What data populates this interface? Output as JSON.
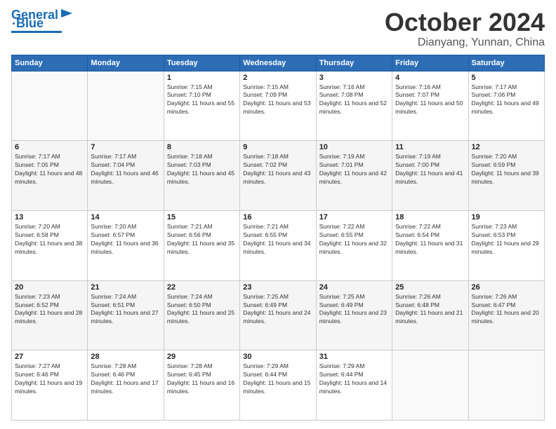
{
  "header": {
    "logo_line1": "General",
    "logo_line2": "Blue",
    "title": "October 2024",
    "location": "Dianyang, Yunnan, China"
  },
  "columns": [
    "Sunday",
    "Monday",
    "Tuesday",
    "Wednesday",
    "Thursday",
    "Friday",
    "Saturday"
  ],
  "weeks": [
    [
      {
        "day": "",
        "sunrise": "",
        "sunset": "",
        "daylight": ""
      },
      {
        "day": "",
        "sunrise": "",
        "sunset": "",
        "daylight": ""
      },
      {
        "day": "1",
        "sunrise": "Sunrise: 7:15 AM",
        "sunset": "Sunset: 7:10 PM",
        "daylight": "Daylight: 11 hours and 55 minutes."
      },
      {
        "day": "2",
        "sunrise": "Sunrise: 7:15 AM",
        "sunset": "Sunset: 7:09 PM",
        "daylight": "Daylight: 11 hours and 53 minutes."
      },
      {
        "day": "3",
        "sunrise": "Sunrise: 7:16 AM",
        "sunset": "Sunset: 7:08 PM",
        "daylight": "Daylight: 11 hours and 52 minutes."
      },
      {
        "day": "4",
        "sunrise": "Sunrise: 7:16 AM",
        "sunset": "Sunset: 7:07 PM",
        "daylight": "Daylight: 11 hours and 50 minutes."
      },
      {
        "day": "5",
        "sunrise": "Sunrise: 7:17 AM",
        "sunset": "Sunset: 7:06 PM",
        "daylight": "Daylight: 11 hours and 49 minutes."
      }
    ],
    [
      {
        "day": "6",
        "sunrise": "Sunrise: 7:17 AM",
        "sunset": "Sunset: 7:05 PM",
        "daylight": "Daylight: 11 hours and 48 minutes."
      },
      {
        "day": "7",
        "sunrise": "Sunrise: 7:17 AM",
        "sunset": "Sunset: 7:04 PM",
        "daylight": "Daylight: 11 hours and 46 minutes."
      },
      {
        "day": "8",
        "sunrise": "Sunrise: 7:18 AM",
        "sunset": "Sunset: 7:03 PM",
        "daylight": "Daylight: 11 hours and 45 minutes."
      },
      {
        "day": "9",
        "sunrise": "Sunrise: 7:18 AM",
        "sunset": "Sunset: 7:02 PM",
        "daylight": "Daylight: 11 hours and 43 minutes."
      },
      {
        "day": "10",
        "sunrise": "Sunrise: 7:19 AM",
        "sunset": "Sunset: 7:01 PM",
        "daylight": "Daylight: 11 hours and 42 minutes."
      },
      {
        "day": "11",
        "sunrise": "Sunrise: 7:19 AM",
        "sunset": "Sunset: 7:00 PM",
        "daylight": "Daylight: 11 hours and 41 minutes."
      },
      {
        "day": "12",
        "sunrise": "Sunrise: 7:20 AM",
        "sunset": "Sunset: 6:59 PM",
        "daylight": "Daylight: 11 hours and 39 minutes."
      }
    ],
    [
      {
        "day": "13",
        "sunrise": "Sunrise: 7:20 AM",
        "sunset": "Sunset: 6:58 PM",
        "daylight": "Daylight: 11 hours and 38 minutes."
      },
      {
        "day": "14",
        "sunrise": "Sunrise: 7:20 AM",
        "sunset": "Sunset: 6:57 PM",
        "daylight": "Daylight: 11 hours and 36 minutes."
      },
      {
        "day": "15",
        "sunrise": "Sunrise: 7:21 AM",
        "sunset": "Sunset: 6:56 PM",
        "daylight": "Daylight: 11 hours and 35 minutes."
      },
      {
        "day": "16",
        "sunrise": "Sunrise: 7:21 AM",
        "sunset": "Sunset: 6:55 PM",
        "daylight": "Daylight: 11 hours and 34 minutes."
      },
      {
        "day": "17",
        "sunrise": "Sunrise: 7:22 AM",
        "sunset": "Sunset: 6:55 PM",
        "daylight": "Daylight: 11 hours and 32 minutes."
      },
      {
        "day": "18",
        "sunrise": "Sunrise: 7:22 AM",
        "sunset": "Sunset: 6:54 PM",
        "daylight": "Daylight: 11 hours and 31 minutes."
      },
      {
        "day": "19",
        "sunrise": "Sunrise: 7:23 AM",
        "sunset": "Sunset: 6:53 PM",
        "daylight": "Daylight: 11 hours and 29 minutes."
      }
    ],
    [
      {
        "day": "20",
        "sunrise": "Sunrise: 7:23 AM",
        "sunset": "Sunset: 6:52 PM",
        "daylight": "Daylight: 11 hours and 28 minutes."
      },
      {
        "day": "21",
        "sunrise": "Sunrise: 7:24 AM",
        "sunset": "Sunset: 6:51 PM",
        "daylight": "Daylight: 11 hours and 27 minutes."
      },
      {
        "day": "22",
        "sunrise": "Sunrise: 7:24 AM",
        "sunset": "Sunset: 6:50 PM",
        "daylight": "Daylight: 11 hours and 25 minutes."
      },
      {
        "day": "23",
        "sunrise": "Sunrise: 7:25 AM",
        "sunset": "Sunset: 6:49 PM",
        "daylight": "Daylight: 11 hours and 24 minutes."
      },
      {
        "day": "24",
        "sunrise": "Sunrise: 7:25 AM",
        "sunset": "Sunset: 6:49 PM",
        "daylight": "Daylight: 11 hours and 23 minutes."
      },
      {
        "day": "25",
        "sunrise": "Sunrise: 7:26 AM",
        "sunset": "Sunset: 6:48 PM",
        "daylight": "Daylight: 11 hours and 21 minutes."
      },
      {
        "day": "26",
        "sunrise": "Sunrise: 7:26 AM",
        "sunset": "Sunset: 6:47 PM",
        "daylight": "Daylight: 11 hours and 20 minutes."
      }
    ],
    [
      {
        "day": "27",
        "sunrise": "Sunrise: 7:27 AM",
        "sunset": "Sunset: 6:46 PM",
        "daylight": "Daylight: 11 hours and 19 minutes."
      },
      {
        "day": "28",
        "sunrise": "Sunrise: 7:28 AM",
        "sunset": "Sunset: 6:46 PM",
        "daylight": "Daylight: 11 hours and 17 minutes."
      },
      {
        "day": "29",
        "sunrise": "Sunrise: 7:28 AM",
        "sunset": "Sunset: 6:45 PM",
        "daylight": "Daylight: 11 hours and 16 minutes."
      },
      {
        "day": "30",
        "sunrise": "Sunrise: 7:29 AM",
        "sunset": "Sunset: 6:44 PM",
        "daylight": "Daylight: 11 hours and 15 minutes."
      },
      {
        "day": "31",
        "sunrise": "Sunrise: 7:29 AM",
        "sunset": "Sunset: 6:44 PM",
        "daylight": "Daylight: 11 hours and 14 minutes."
      },
      {
        "day": "",
        "sunrise": "",
        "sunset": "",
        "daylight": ""
      },
      {
        "day": "",
        "sunrise": "",
        "sunset": "",
        "daylight": ""
      }
    ]
  ]
}
